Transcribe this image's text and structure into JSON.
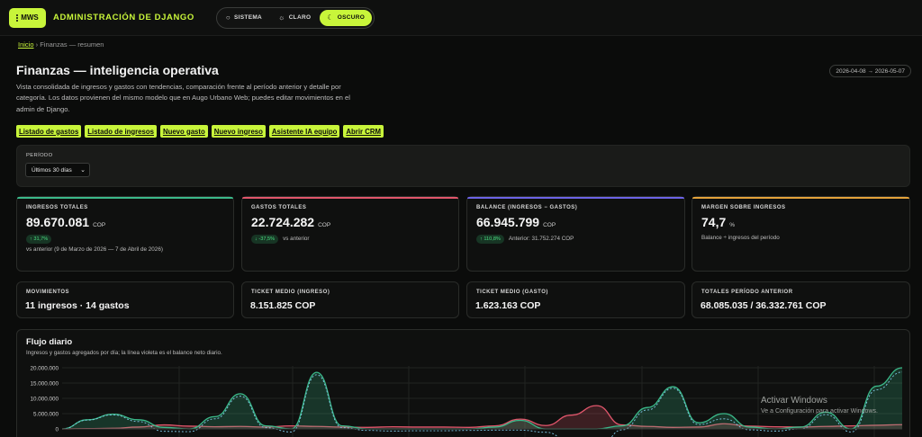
{
  "header": {
    "logo_text": "MWS",
    "title": "ADMINISTRACIÓN DE DJANGO",
    "theme_options": [
      {
        "label": "SISTEMA",
        "icon": "circle-icon"
      },
      {
        "label": "CLARO",
        "icon": "sun-icon"
      },
      {
        "label": "OSCURO",
        "icon": "moon-icon",
        "active": true
      }
    ]
  },
  "breadcrumb": {
    "home": "Inicio",
    "separator": "›",
    "current": "Finanzas — resumen"
  },
  "page": {
    "title": "Finanzas — inteligencia operativa",
    "date_range": "2026-04-08 → 2026-05-07",
    "description": "Vista consolidada de ingresos y gastos con tendencias, comparación frente al período anterior y detalle por categoría. Los datos provienen del mismo modelo que en Augo Urbano Web; puedes editar movimientos en el admin de Django."
  },
  "quick_links": [
    "Listado de gastos",
    "Listado de ingresos",
    "Nuevo gasto",
    "Nuevo ingreso",
    "Asistente IA equipo",
    "Abrir CRM"
  ],
  "filter": {
    "label": "PERÍODO",
    "selected": "Últimos 30 días"
  },
  "kpis": [
    {
      "label": "INGRESOS TOTALES",
      "value": "89.670.081",
      "unit": "COP",
      "badge": "↑ 31,7%",
      "note": "vs anterior (9 de Marzo de 2026 — 7 de Abril de 2026)",
      "accent": "#3bb98a"
    },
    {
      "label": "GASTOS TOTALES",
      "value": "22.724.282",
      "unit": "COP",
      "badge": "↓ -37,5%",
      "note": "vs anterior",
      "accent": "#e0566b"
    },
    {
      "label": "BALANCE (INGRESOS − GASTOS)",
      "value": "66.945.799",
      "unit": "COP",
      "badge": "↑ 110,8%",
      "note": "Anterior: 31.752.274 COP",
      "accent": "#6c63e6"
    },
    {
      "label": "MARGEN SOBRE INGRESOS",
      "value": "74,7",
      "unit": "%",
      "badge": "",
      "note": "Balance ÷ ingresos del período",
      "accent": "#e3a23a"
    }
  ],
  "stats": [
    {
      "label": "MOVIMIENTOS",
      "value": "11 ingresos · 14 gastos"
    },
    {
      "label": "TICKET MEDIO (INGRESO)",
      "value": "8.151.825 COP"
    },
    {
      "label": "TICKET MEDIO (GASTO)",
      "value": "1.623.163 COP"
    },
    {
      "label": "TOTALES PERÍODO ANTERIOR",
      "value": "68.085.035 / 36.332.761 COP"
    }
  ],
  "chart": {
    "title": "Flujo diario",
    "subtitle": "Ingresos y gastos agregados por día; la línea violeta es el balance neto diario."
  },
  "chart_data": {
    "type": "area",
    "y_ticks": [
      "20.000.000",
      "15.000.000",
      "10.000.000",
      "5.000.000",
      "0"
    ],
    "ylim": [
      0,
      20000000
    ],
    "colors": {
      "ingresos": "#3bb98a",
      "gastos": "#e0566b",
      "balance": "#6c63e6"
    },
    "series": [
      {
        "key": "ingresos",
        "values": [
          0,
          3000000,
          4800000,
          3000000,
          500000,
          0,
          4000000,
          11500000,
          1000000,
          0,
          18500000,
          1000000,
          0,
          0,
          0,
          0,
          0,
          600000,
          2800000,
          0,
          0,
          0,
          1000000,
          7000000,
          13800000,
          2000000,
          5000000,
          600000,
          0,
          600000,
          5500000,
          0,
          14000000,
          20000000
        ]
      },
      {
        "key": "gastos",
        "values": [
          0,
          100000,
          200000,
          600000,
          1300000,
          900000,
          700000,
          800000,
          600000,
          1000000,
          800000,
          600000,
          500000,
          700000,
          600000,
          600000,
          500000,
          1000000,
          3200000,
          1100000,
          4500000,
          7600000,
          1300000,
          800000,
          500000,
          600000,
          1700000,
          900000,
          700000,
          600000,
          800000,
          1000000,
          1200000,
          1400000
        ]
      }
    ]
  },
  "watermark": {
    "line1": "Activar Windows",
    "line2": "Ve a Configuración para activar Windows."
  }
}
